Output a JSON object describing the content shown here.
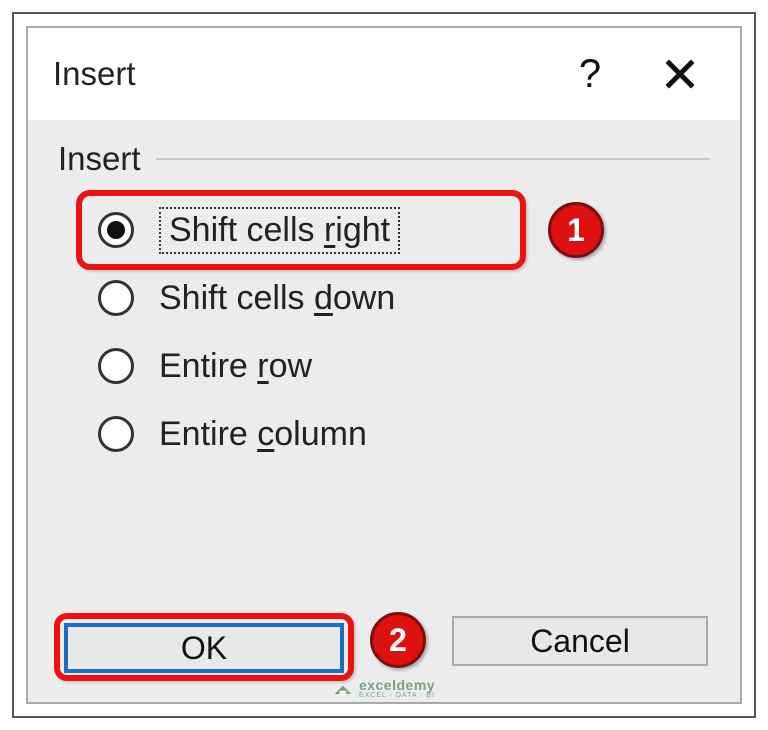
{
  "titlebar": {
    "title": "Insert"
  },
  "group": {
    "label": "Insert"
  },
  "options": {
    "opt1_pre": "Shift cells ",
    "opt1_ul": "r",
    "opt1_post": "ight",
    "opt2_pre": "Shift cells ",
    "opt2_ul": "d",
    "opt2_post": "own",
    "opt3_pre": "Entire ",
    "opt3_ul": "r",
    "opt3_post": "ow",
    "opt4_pre": "Entire ",
    "opt4_ul": "c",
    "opt4_post": "olumn"
  },
  "buttons": {
    "ok": "OK",
    "cancel": "Cancel"
  },
  "annotations": {
    "badge1": "1",
    "badge2": "2"
  },
  "watermark": {
    "main": "exceldemy",
    "sub": "EXCEL · DATA · BI"
  }
}
